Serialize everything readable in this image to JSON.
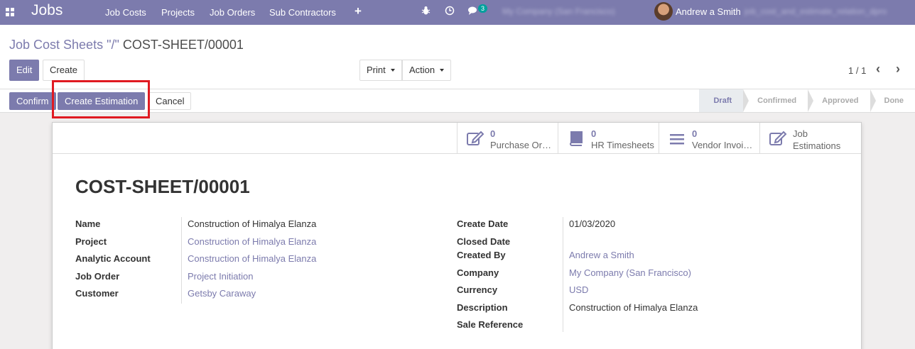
{
  "navbar": {
    "app_title": "Jobs",
    "menu": [
      "Job Costs",
      "Projects",
      "Job Orders",
      "Sub Contractors"
    ],
    "messages_count": "3",
    "company": "My Company (San Francisco)",
    "user": "Andrew a Smith",
    "db": "job_cost_and_estimate_relation_dpro"
  },
  "breadcrumb": {
    "parent": "Job Cost Sheets \"/\"",
    "current": "COST-SHEET/00001"
  },
  "buttons": {
    "edit": "Edit",
    "create": "Create",
    "print": "Print",
    "action": "Action"
  },
  "pager": {
    "value": "1 / 1"
  },
  "statusbar": {
    "confirm": "Confirm",
    "create_estimation": "Create Estimation",
    "cancel": "Cancel",
    "stages": [
      "Draft",
      "Confirmed",
      "Approved",
      "Done"
    ],
    "active_stage": "Draft"
  },
  "smart_buttons": [
    {
      "count": "0",
      "label": "Purchase Orders",
      "icon": "edit-icon"
    },
    {
      "count": "0",
      "label": "HR Timesheets",
      "icon": "book-icon"
    },
    {
      "count": "0",
      "label": "Vendor Invoices",
      "icon": "list-icon"
    },
    {
      "label_line1": "Job",
      "label_line2": "Estimations",
      "icon": "edit-icon"
    }
  ],
  "record": {
    "title": "COST-SHEET/00001",
    "left": [
      {
        "label": "Name",
        "value": "Construction of Himalya Elanza",
        "link": false
      },
      {
        "label": "Project",
        "value": "Construction of Himalya Elanza",
        "link": true
      },
      {
        "label": "Analytic Account",
        "value": "Construction of Himalya Elanza",
        "link": true
      },
      {
        "label": "Job Order",
        "value": "Project Initiation",
        "link": true
      },
      {
        "label": "Customer",
        "value": "Getsby Caraway",
        "link": true
      }
    ],
    "right": [
      {
        "label": "Create Date",
        "value": "01/03/2020",
        "link": false
      },
      {
        "label": "Closed Date",
        "value": "",
        "link": false
      },
      {
        "label": "Created By",
        "value": "Andrew a Smith",
        "link": true
      },
      {
        "label": "Company",
        "value": "My Company (San Francisco)",
        "link": true
      },
      {
        "label": "Currency",
        "value": "USD",
        "link": true
      },
      {
        "label": "Description",
        "value": "Construction of Himalya Elanza",
        "link": false
      },
      {
        "label": "Sale Reference",
        "value": "",
        "link": false
      }
    ]
  },
  "colors": {
    "brand": "#7c7bad",
    "highlight": "#e01a22",
    "badge": "#00a09d"
  }
}
